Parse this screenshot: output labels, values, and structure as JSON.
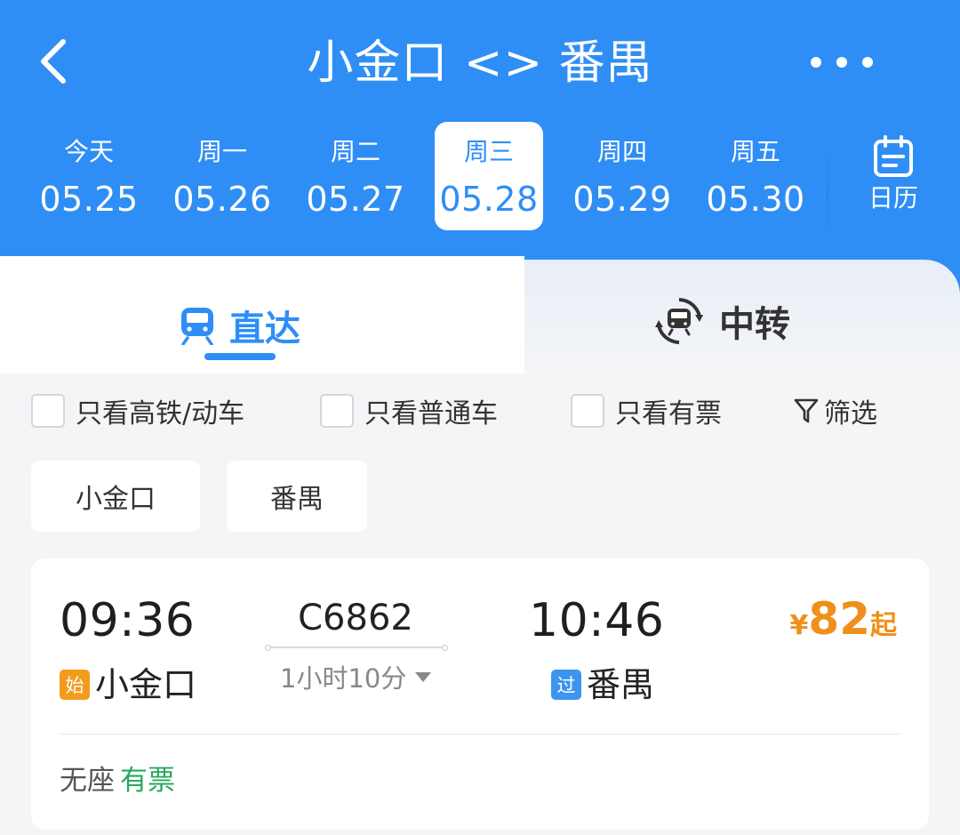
{
  "header": {
    "title": "小金口 <> 番禺",
    "back_icon": "chevron-left-icon",
    "more_icon": "more-dots-icon"
  },
  "dates": [
    {
      "dow": "今天",
      "date": "05.25",
      "selected": false
    },
    {
      "dow": "周一",
      "date": "05.26",
      "selected": false
    },
    {
      "dow": "周二",
      "date": "05.27",
      "selected": false
    },
    {
      "dow": "周三",
      "date": "05.28",
      "selected": true
    },
    {
      "dow": "周四",
      "date": "05.29",
      "selected": false
    },
    {
      "dow": "周五",
      "date": "05.30",
      "selected": false
    }
  ],
  "calendar": {
    "label": "日历",
    "icon": "calendar-icon"
  },
  "tabs": {
    "direct": {
      "label": "直达",
      "icon": "train-icon",
      "active": true
    },
    "transfer": {
      "label": "中转",
      "icon": "transfer-train-icon",
      "active": false
    }
  },
  "filters": {
    "high_speed_only": "只看高铁/动车",
    "normal_only": "只看普通车",
    "available_only": "只看有票",
    "screen": "筛选",
    "screen_icon": "filter-funnel-icon"
  },
  "station_chips": [
    "小金口",
    "番禺"
  ],
  "train": {
    "departure_time": "09:36",
    "departure_station": "小金口",
    "departure_badge": "始",
    "train_number": "C6862",
    "duration": "1小时10分",
    "arrival_time": "10:46",
    "arrival_station": "番禺",
    "arrival_badge": "过",
    "price_currency": "¥",
    "price_amount": "82",
    "price_suffix": "起",
    "seat_type": "无座",
    "seat_status": "有票"
  },
  "colors": {
    "primary_blue": "#2f8ef5",
    "price_orange": "#f0901c",
    "available_green": "#27a85b",
    "start_badge": "#f29b1c",
    "pass_badge": "#3d95f0"
  }
}
